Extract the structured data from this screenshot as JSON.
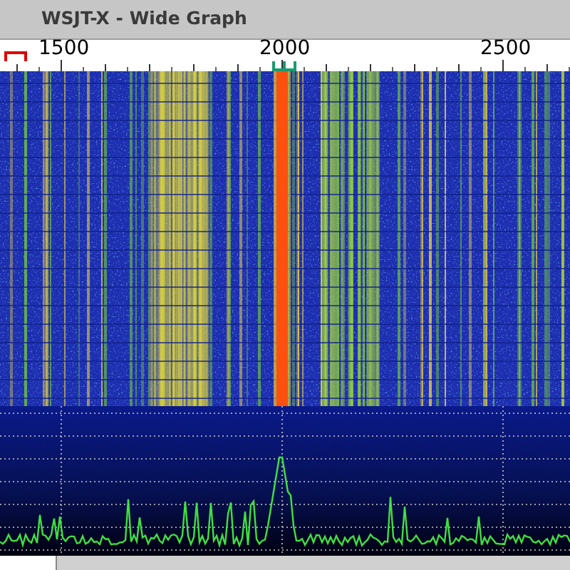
{
  "window": {
    "title": "WSJT-X - Wide Graph"
  },
  "scale": {
    "labels": [
      "1500",
      "2000",
      "2500"
    ]
  }
}
